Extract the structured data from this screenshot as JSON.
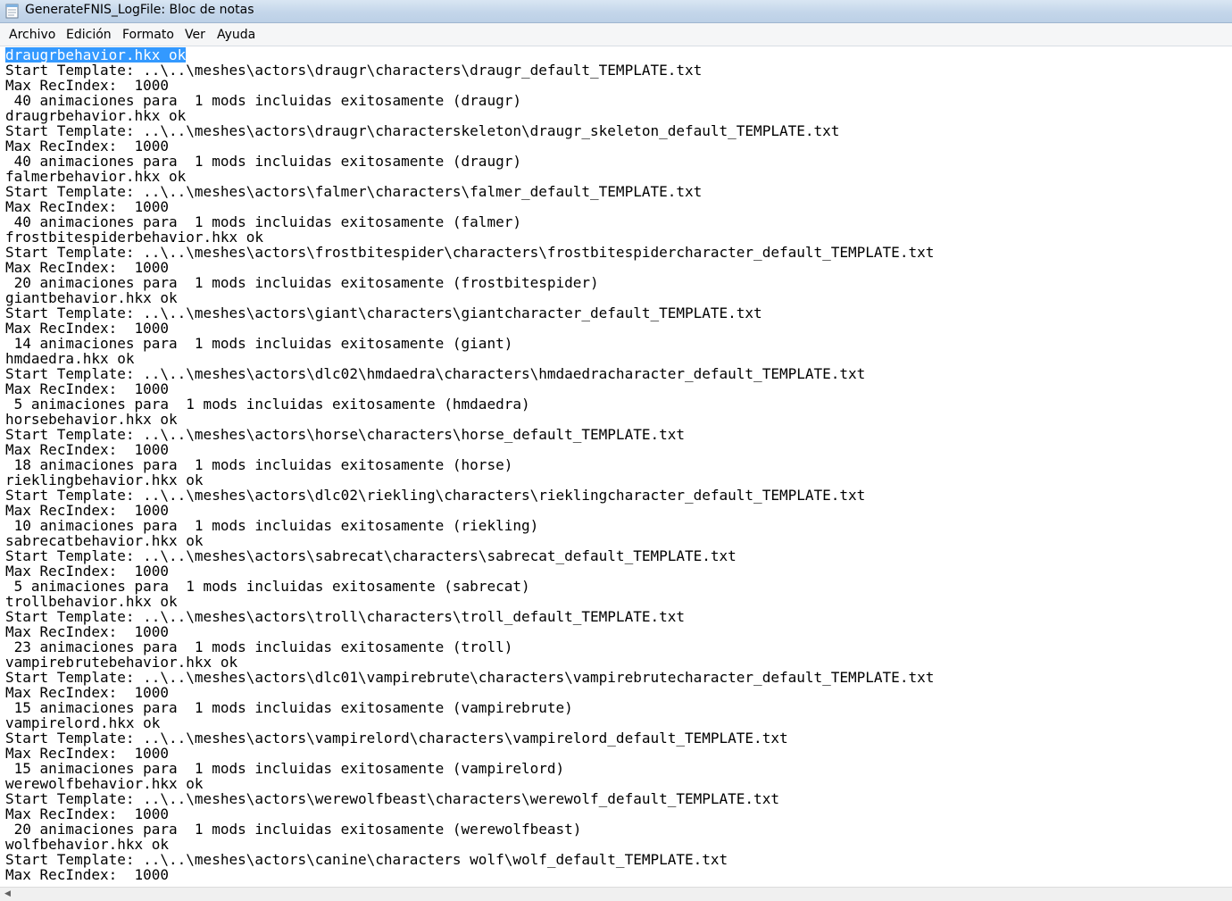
{
  "window": {
    "title": "GenerateFNIS_LogFile: Bloc de notas",
    "icon": "notepad-icon"
  },
  "menu": [
    "Archivo",
    "Edición",
    "Formato",
    "Ver",
    "Ayuda"
  ],
  "editor": {
    "selected_line": 0,
    "lines": [
      "draugrbehavior.hkx ok",
      "Start Template: ..\\..\\meshes\\actors\\draugr\\characters\\draugr_default_TEMPLATE.txt",
      "Max RecIndex:  1000",
      " 40 animaciones para  1 mods incluidas exitosamente (draugr)",
      "draugrbehavior.hkx ok",
      "Start Template: ..\\..\\meshes\\actors\\draugr\\characterskeleton\\draugr_skeleton_default_TEMPLATE.txt",
      "Max RecIndex:  1000",
      " 40 animaciones para  1 mods incluidas exitosamente (draugr)",
      "falmerbehavior.hkx ok",
      "Start Template: ..\\..\\meshes\\actors\\falmer\\characters\\falmer_default_TEMPLATE.txt",
      "Max RecIndex:  1000",
      " 40 animaciones para  1 mods incluidas exitosamente (falmer)",
      "frostbitespiderbehavior.hkx ok",
      "Start Template: ..\\..\\meshes\\actors\\frostbitespider\\characters\\frostbitespidercharacter_default_TEMPLATE.txt",
      "Max RecIndex:  1000",
      " 20 animaciones para  1 mods incluidas exitosamente (frostbitespider)",
      "giantbehavior.hkx ok",
      "Start Template: ..\\..\\meshes\\actors\\giant\\characters\\giantcharacter_default_TEMPLATE.txt",
      "Max RecIndex:  1000",
      " 14 animaciones para  1 mods incluidas exitosamente (giant)",
      "hmdaedra.hkx ok",
      "Start Template: ..\\..\\meshes\\actors\\dlc02\\hmdaedra\\characters\\hmdaedracharacter_default_TEMPLATE.txt",
      "Max RecIndex:  1000",
      " 5 animaciones para  1 mods incluidas exitosamente (hmdaedra)",
      "horsebehavior.hkx ok",
      "Start Template: ..\\..\\meshes\\actors\\horse\\characters\\horse_default_TEMPLATE.txt",
      "Max RecIndex:  1000",
      " 18 animaciones para  1 mods incluidas exitosamente (horse)",
      "rieklingbehavior.hkx ok",
      "Start Template: ..\\..\\meshes\\actors\\dlc02\\riekling\\characters\\rieklingcharacter_default_TEMPLATE.txt",
      "Max RecIndex:  1000",
      " 10 animaciones para  1 mods incluidas exitosamente (riekling)",
      "sabrecatbehavior.hkx ok",
      "Start Template: ..\\..\\meshes\\actors\\sabrecat\\characters\\sabrecat_default_TEMPLATE.txt",
      "Max RecIndex:  1000",
      " 5 animaciones para  1 mods incluidas exitosamente (sabrecat)",
      "trollbehavior.hkx ok",
      "Start Template: ..\\..\\meshes\\actors\\troll\\characters\\troll_default_TEMPLATE.txt",
      "Max RecIndex:  1000",
      " 23 animaciones para  1 mods incluidas exitosamente (troll)",
      "vampirebrutebehavior.hkx ok",
      "Start Template: ..\\..\\meshes\\actors\\dlc01\\vampirebrute\\characters\\vampirebrutecharacter_default_TEMPLATE.txt",
      "Max RecIndex:  1000",
      " 15 animaciones para  1 mods incluidas exitosamente (vampirebrute)",
      "vampirelord.hkx ok",
      "Start Template: ..\\..\\meshes\\actors\\vampirelord\\characters\\vampirelord_default_TEMPLATE.txt",
      "Max RecIndex:  1000",
      " 15 animaciones para  1 mods incluidas exitosamente (vampirelord)",
      "werewolfbehavior.hkx ok",
      "Start Template: ..\\..\\meshes\\actors\\werewolfbeast\\characters\\werewolf_default_TEMPLATE.txt",
      "Max RecIndex:  1000",
      " 20 animaciones para  1 mods incluidas exitosamente (werewolfbeast)",
      "wolfbehavior.hkx ok",
      "Start Template: ..\\..\\meshes\\actors\\canine\\characters wolf\\wolf_default_TEMPLATE.txt",
      "Max RecIndex:  1000"
    ]
  },
  "colors": {
    "selection": "#3399ff",
    "selection_text": "#ffffff",
    "text": "#000000"
  }
}
